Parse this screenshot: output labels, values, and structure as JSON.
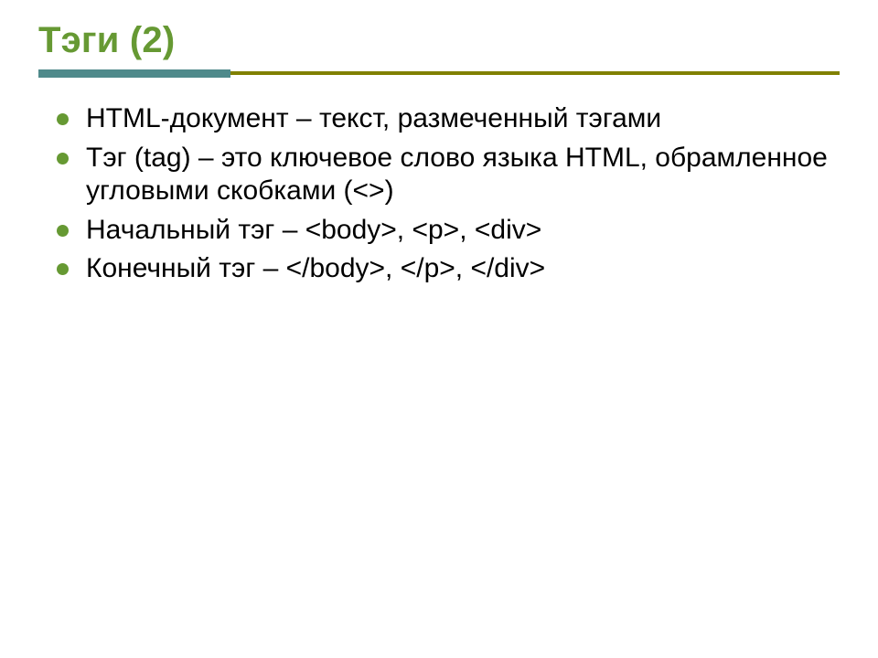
{
  "title": "Тэги   (2)",
  "bullets": [
    "HTML-документ – текст, размеченный тэгами",
    "Тэг (tag) – это ключевое слово языка HTML, обрамленное угловыми скобками (<>)",
    "Начальный тэг – <body>, <p>, <div>",
    "Конечный тэг  – </body>, </p>, </div>"
  ]
}
